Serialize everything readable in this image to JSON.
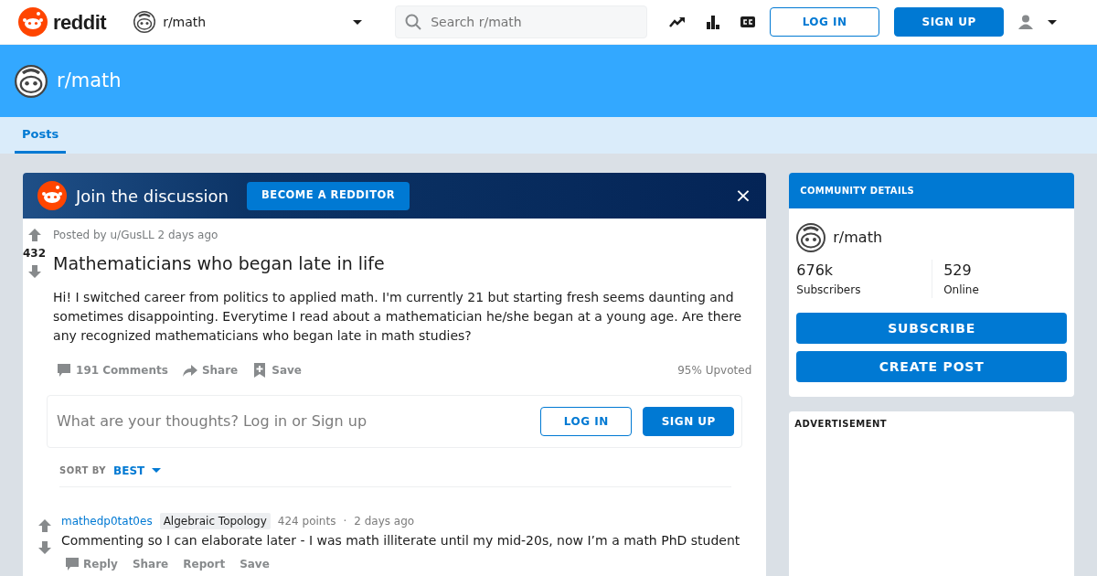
{
  "header": {
    "logo_text": "reddit",
    "community": "r/math",
    "search": {
      "placeholder": "Search r/math"
    },
    "login": "LOG IN",
    "signup": "SIGN UP"
  },
  "banner": {
    "title": "r/math"
  },
  "tabs": [
    {
      "label": "Posts",
      "selected": true
    }
  ],
  "join": {
    "text": "Join the discussion",
    "button": "BECOME A REDDITOR",
    "close": "×"
  },
  "post": {
    "score": "432",
    "meta": "Posted by u/GusLL 2 days ago",
    "title": "Mathematicians who began late in life",
    "body": "Hi! I switched career from politics to applied math. I'm currently 21 but starting fresh seems daunting and sometimes disappointing. Everytime I read about a mathematician he/she began at a young age. Are there any recognized mathematicians who began late in math studies?",
    "actions": [
      {
        "kind": "comments",
        "label": "191 Comments"
      },
      {
        "kind": "share",
        "label": "Share"
      },
      {
        "kind": "save",
        "label": "Save"
      }
    ],
    "upvoted": "95% Upvoted"
  },
  "comment_box": {
    "placeholder": "What are your thoughts? Log in or Sign up",
    "login": "LOG IN",
    "signup": "SIGN UP"
  },
  "sort": {
    "label": "SORT BY",
    "value": "BEST"
  },
  "comments": [
    {
      "author": "mathedp0tat0es",
      "flair": "Algebraic Topology",
      "points": "424 points",
      "separator": "·",
      "time": "2 days ago",
      "text": "Commenting so I can elaborate later - I was math illiterate until my mid-20s, now I’m a math PhD student",
      "actions": [
        {
          "kind": "reply",
          "label": "Reply"
        },
        {
          "kind": "plain",
          "label": "Share"
        },
        {
          "kind": "plain",
          "label": "Report"
        },
        {
          "kind": "plain",
          "label": "Save"
        }
      ]
    }
  ],
  "sidebar": {
    "heading": "COMMUNITY DETAILS",
    "name": "r/math",
    "stats": [
      {
        "value": "676k",
        "label": "Subscribers"
      },
      {
        "value": "529",
        "label": "Online"
      }
    ],
    "buttons": [
      "SUBSCRIBE",
      "CREATE POST"
    ],
    "ad_label": "ADVERTISEMENT"
  }
}
